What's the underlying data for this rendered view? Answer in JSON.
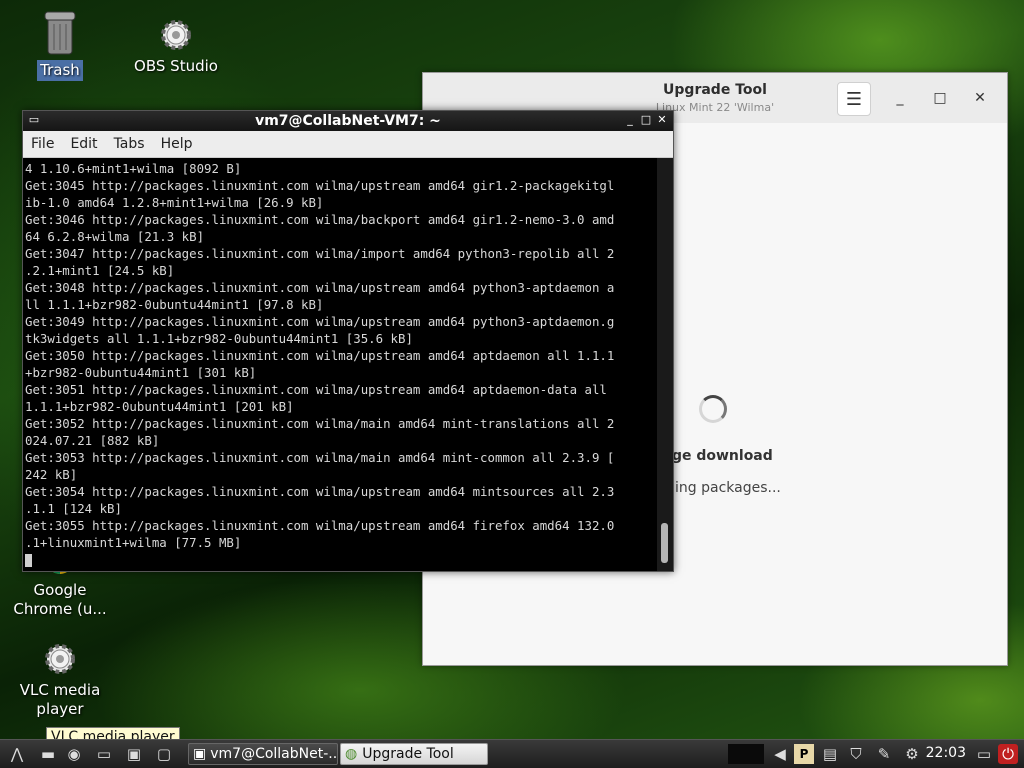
{
  "desktop": {
    "icons": [
      {
        "label": "Trash",
        "icon": "trash-icon"
      },
      {
        "label": "OBS Studio",
        "icon": "gear-icon"
      },
      {
        "label": "Google Chrome (u...",
        "icon": "chrome-icon"
      },
      {
        "label": "VLC media player",
        "icon": "gear-icon"
      }
    ],
    "tooltip": "VLC media player"
  },
  "upgrade_tool": {
    "title": "Upgrade Tool",
    "subtitle": "Linux Mint 22 'Wilma'",
    "heading": "kage download",
    "status": "loading packages..."
  },
  "terminal": {
    "title": "vm7@CollabNet-VM7: ~",
    "menu": [
      "File",
      "Edit",
      "Tabs",
      "Help"
    ],
    "lines": [
      "4 1.10.6+mint1+wilma [8092 B]",
      "Get:3045 http://packages.linuxmint.com wilma/upstream amd64 gir1.2-packagekitgl",
      "ib-1.0 amd64 1.2.8+mint1+wilma [26.9 kB]",
      "Get:3046 http://packages.linuxmint.com wilma/backport amd64 gir1.2-nemo-3.0 amd",
      "64 6.2.8+wilma [21.3 kB]",
      "Get:3047 http://packages.linuxmint.com wilma/import amd64 python3-repolib all 2",
      ".2.1+mint1 [24.5 kB]",
      "Get:3048 http://packages.linuxmint.com wilma/upstream amd64 python3-aptdaemon a",
      "ll 1.1.1+bzr982-0ubuntu44mint1 [97.8 kB]",
      "Get:3049 http://packages.linuxmint.com wilma/upstream amd64 python3-aptdaemon.g",
      "tk3widgets all 1.1.1+bzr982-0ubuntu44mint1 [35.6 kB]",
      "Get:3050 http://packages.linuxmint.com wilma/upstream amd64 aptdaemon all 1.1.1",
      "+bzr982-0ubuntu44mint1 [301 kB]",
      "Get:3051 http://packages.linuxmint.com wilma/upstream amd64 aptdaemon-data all",
      "1.1.1+bzr982-0ubuntu44mint1 [201 kB]",
      "Get:3052 http://packages.linuxmint.com wilma/main amd64 mint-translations all 2",
      "024.07.21 [882 kB]",
      "Get:3053 http://packages.linuxmint.com wilma/main amd64 mint-common all 2.3.9 [",
      "242 kB]",
      "Get:3054 http://packages.linuxmint.com wilma/upstream amd64 mintsources all 2.3",
      ".1.1 [124 kB]",
      "Get:3055 http://packages.linuxmint.com wilma/upstream amd64 firefox amd64 132.0",
      ".1+linuxmint1+wilma [77.5 MB]"
    ]
  },
  "taskbar": {
    "tasks": [
      "vm7@CollabNet-...",
      "Upgrade Tool"
    ],
    "clock": "22:03"
  }
}
